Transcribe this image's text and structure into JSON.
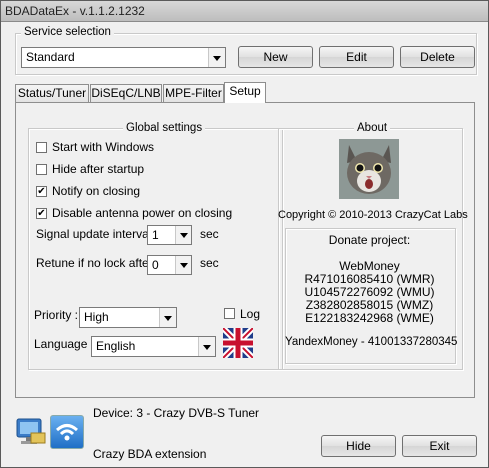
{
  "window": {
    "title": "BDADataEx - v.1.1.2.1232"
  },
  "service": {
    "group_label": "Service selection",
    "selected": "Standard",
    "buttons": {
      "new": "New",
      "edit": "Edit",
      "delete": "Delete"
    }
  },
  "tabs": [
    {
      "label": "Status/Tuner"
    },
    {
      "label": "DiSEqC/LNB"
    },
    {
      "label": "MPE-Filter"
    },
    {
      "label": "Setup",
      "active": true
    }
  ],
  "global": {
    "label": "Global settings",
    "options": [
      {
        "label": "Start with Windows",
        "checked": false
      },
      {
        "label": "Hide after startup",
        "checked": false
      },
      {
        "label": "Notify on closing",
        "checked": true
      },
      {
        "label": "Disable antenna power on closing",
        "checked": true
      }
    ],
    "signal_update": {
      "label": "Signal update interval",
      "value": "1",
      "unit": "sec"
    },
    "retune": {
      "label": "Retune if no lock after",
      "value": "0",
      "unit": "sec"
    },
    "priority": {
      "label": "Priority :",
      "value": "High"
    },
    "log": {
      "label": "Log",
      "checked": false
    },
    "language": {
      "label": "Language :",
      "value": "English"
    }
  },
  "about": {
    "label": "About",
    "copyright": "Copyright © 2010-2013 CrazyCat Labs",
    "donate_title": "Donate project:",
    "webmoney_title": "WebMoney",
    "webmoney": [
      "R471016085410 (WMR)",
      "U104572276092 (WMU)",
      "Z382802858015 (WMZ)",
      "E122183242968 (WME)"
    ],
    "yandex": "YandexMoney - 41001337280345"
  },
  "footer": {
    "device": "Device: 3 - Crazy DVB-S Tuner",
    "extension": "Crazy BDA extension",
    "hide": "Hide",
    "exit": "Exit"
  },
  "colors": {
    "accent": "#3a79c9",
    "flag_blue": "#1f3d8a",
    "flag_red": "#c8102e"
  }
}
